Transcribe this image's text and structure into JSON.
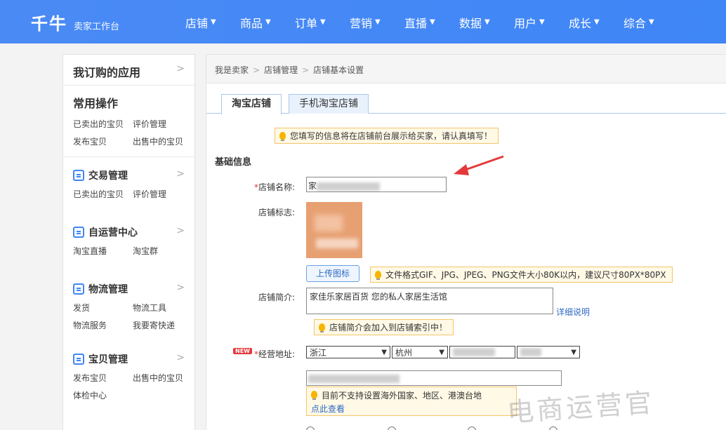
{
  "header": {
    "logo": "千牛",
    "logo_sub": "卖家工作台",
    "nav": [
      "店铺",
      "商品",
      "订单",
      "营销",
      "直播",
      "数据",
      "用户",
      "成长",
      "综合"
    ]
  },
  "sidebar": {
    "apps_title": "我订购的应用",
    "common_title": "常用操作",
    "common_links": [
      "已卖出的宝贝",
      "评价管理",
      "发布宝贝",
      "出售中的宝贝"
    ],
    "groups": [
      {
        "title": "交易管理",
        "links": [
          "已卖出的宝贝",
          "评价管理"
        ]
      },
      {
        "title": "自运营中心",
        "links": [
          "淘宝直播",
          "淘宝群"
        ]
      },
      {
        "title": "物流管理",
        "links": [
          "发货",
          "物流工具",
          "物流服务",
          "我要寄快递"
        ]
      },
      {
        "title": "宝贝管理",
        "links": [
          "发布宝贝",
          "出售中的宝贝",
          "体检中心"
        ]
      }
    ]
  },
  "breadcrumb": [
    "我是卖家",
    "店铺管理",
    "店铺基本设置"
  ],
  "tabs": {
    "active": "淘宝店铺",
    "inactive": "手机淘宝店铺"
  },
  "notice_top": "您填写的信息将在店铺前台展示给买家，请认真填写！",
  "section_title": "基础信息",
  "form": {
    "store_name_label": "店铺名称:",
    "store_name_prefix": "家",
    "store_logo_label": "店铺标志:",
    "upload_btn": "上传图标",
    "upload_tip": "文件格式GIF、JPG、JPEG、PNG文件大小80K以内，建议尺寸80PX*80PX",
    "intro_label": "店铺简介:",
    "intro_value": "家佳乐家居百货 您的私人家居生活馆",
    "detail_link": "详细说明",
    "intro_tip": "店铺简介会加入到店铺索引中！",
    "new_badge": "NEW",
    "address_label": "经营地址:",
    "province": "浙江",
    "city": "杭州",
    "address_tip": "目前不支持设置海外国家、地区、港澳台地",
    "address_link": "点此查看"
  },
  "watermark": "电商运营官",
  "colors": {
    "header": "#3f86f6",
    "accent": "#e4393c",
    "link": "#2f6bc2"
  }
}
